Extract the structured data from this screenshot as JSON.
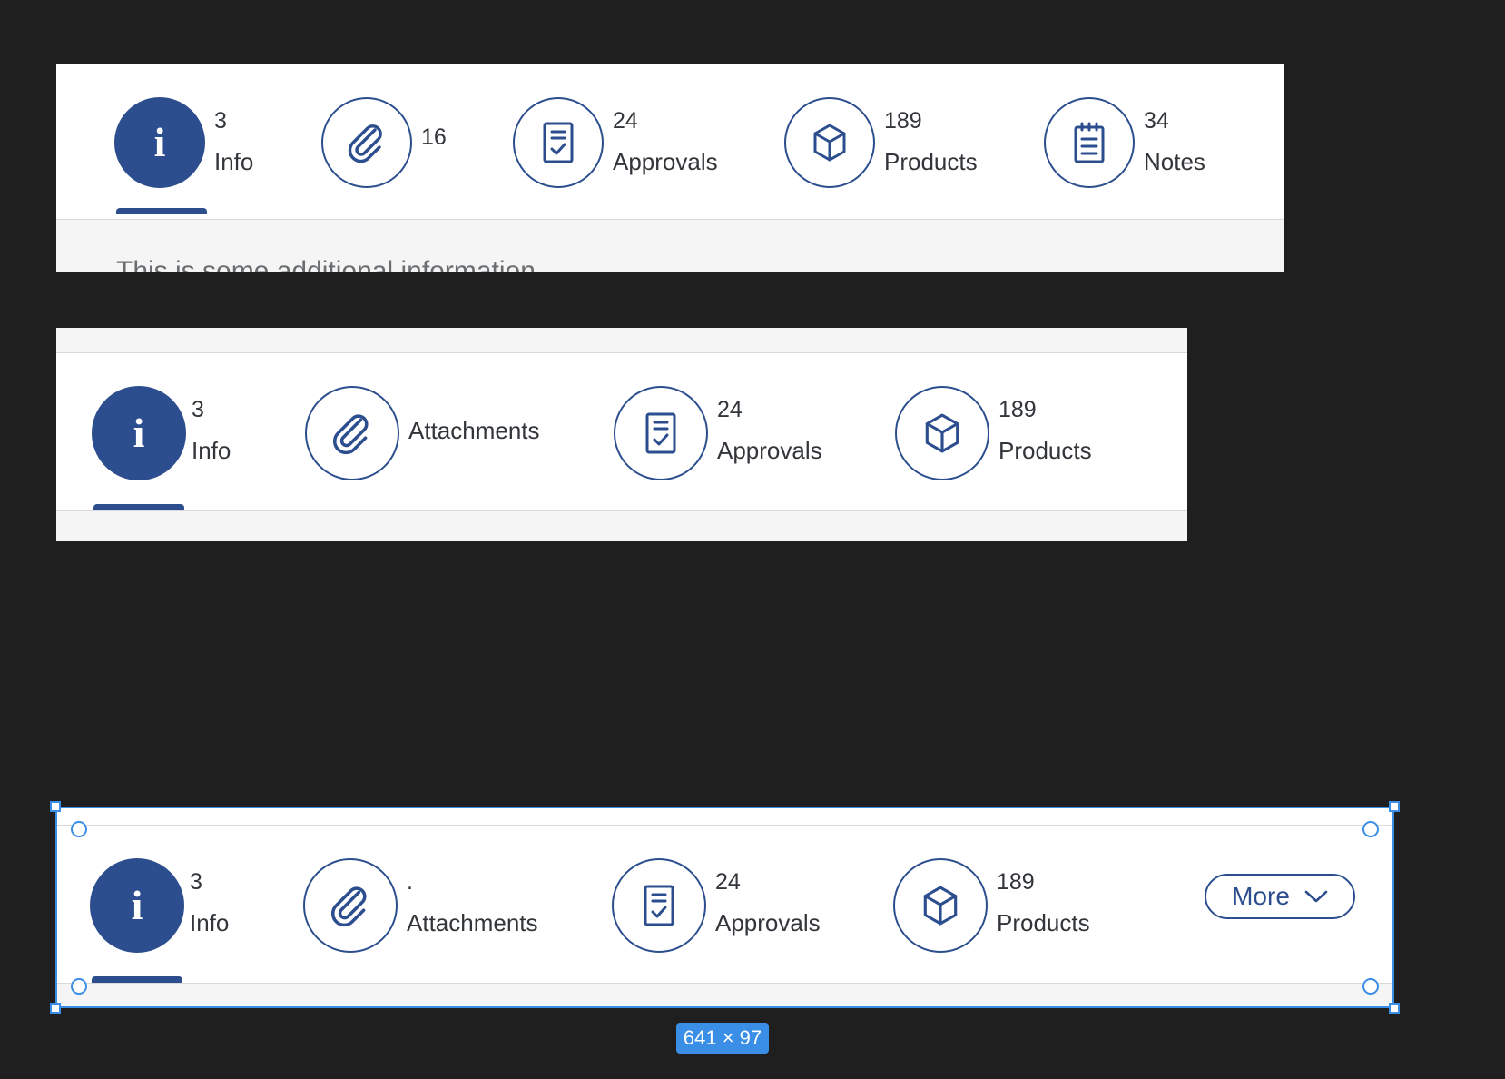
{
  "colors": {
    "accent": "#2c4e8e",
    "selection": "#3a8ee6",
    "canvas": "#1f1f1f",
    "text": "#32363a"
  },
  "panel1": {
    "tabs": [
      {
        "count": "3",
        "label": "Info",
        "icon": "info-icon"
      },
      {
        "count": "16",
        "label": "",
        "icon": "paperclip-icon"
      },
      {
        "count": "24",
        "label": "Approvals",
        "icon": "approval-document-icon"
      },
      {
        "count": "189",
        "label": "Products",
        "icon": "product-box-icon"
      },
      {
        "count": "34",
        "label": "Notes",
        "icon": "notes-icon"
      }
    ],
    "content_text": "This is some additional information"
  },
  "panel2": {
    "tabs": [
      {
        "count": "3",
        "label": "Info",
        "icon": "info-icon"
      },
      {
        "count": "",
        "label": "Attachments",
        "icon": "paperclip-icon"
      },
      {
        "count": "24",
        "label": "Approvals",
        "icon": "approval-document-icon"
      },
      {
        "count": "189",
        "label": "Products",
        "icon": "product-box-icon"
      }
    ]
  },
  "panel3": {
    "tabs": [
      {
        "count": "3",
        "label": "Info",
        "icon": "info-icon"
      },
      {
        "count": ".",
        "label": "Attachments",
        "icon": "paperclip-icon"
      },
      {
        "count": "24",
        "label": "Approvals",
        "icon": "approval-document-icon"
      },
      {
        "count": "189",
        "label": "Products",
        "icon": "product-box-icon"
      }
    ],
    "more_label": "More"
  },
  "info_glyph": "i",
  "selection_badge": "641 × 97"
}
